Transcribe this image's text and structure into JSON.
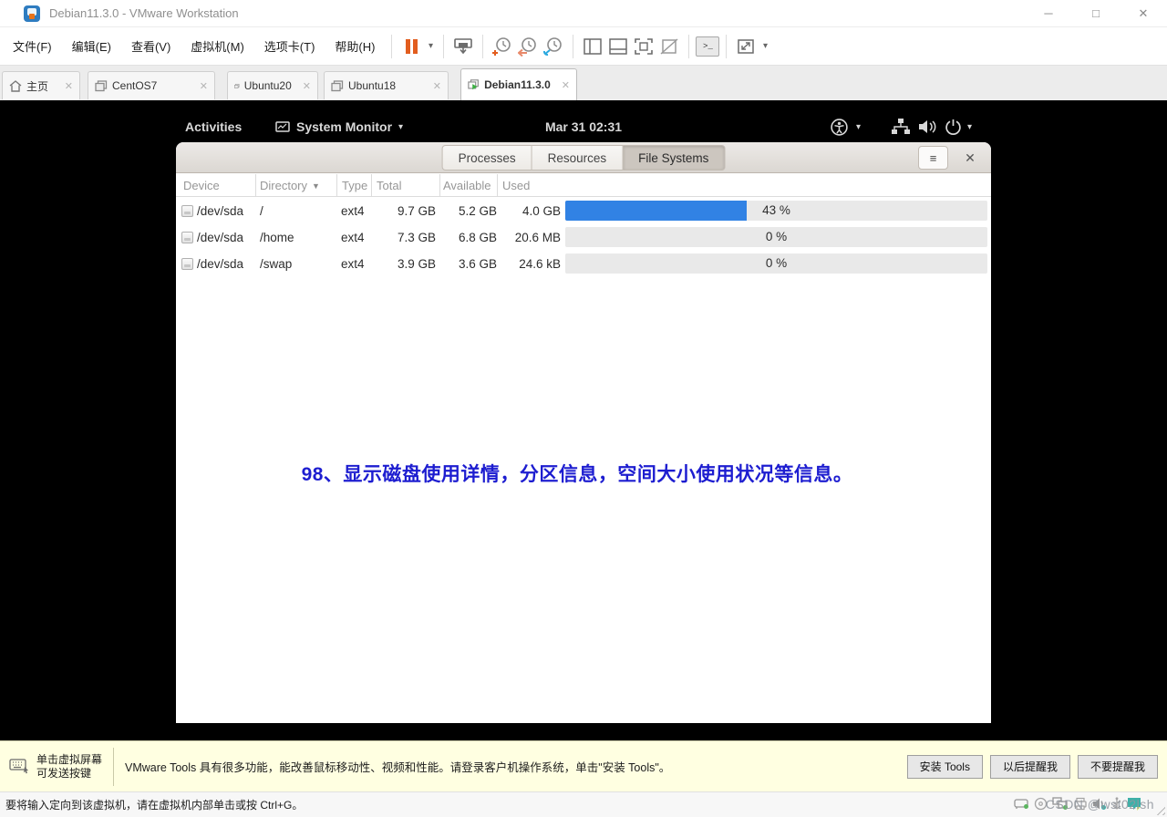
{
  "window": {
    "title": "Debian11.3.0 - VMware Workstation"
  },
  "icons": {
    "minimize_glyph": "─",
    "maximize_glyph": "□",
    "close_glyph": "✕",
    "tab_close_glyph": "✕",
    "caret_glyph": "▾",
    "sort_desc_glyph": "▼",
    "hamburger_glyph": "≡",
    "prompt_glyph": ">_"
  },
  "menu": {
    "items": [
      "文件(F)",
      "编辑(E)",
      "查看(V)",
      "虚拟机(M)",
      "选项卡(T)",
      "帮助(H)"
    ]
  },
  "vm_tabs": {
    "items": [
      {
        "label": "主页"
      },
      {
        "label": "CentOS7"
      },
      {
        "label": "Ubuntu20"
      },
      {
        "label": "Ubuntu18"
      },
      {
        "label": "Debian11.3.0"
      }
    ],
    "active": "Debian11.3.0"
  },
  "gnome": {
    "activities": "Activities",
    "app_name": "System Monitor",
    "clock": "Mar 31  02:31"
  },
  "monitor": {
    "tabs": {
      "processes": "Processes",
      "resources": "Resources",
      "file_systems": "File Systems"
    },
    "active_tab": "File Systems",
    "columns": {
      "device": "Device",
      "directory": "Directory",
      "type": "Type",
      "total": "Total",
      "available": "Available",
      "used": "Used"
    },
    "rows": [
      {
        "device": "/dev/sda",
        "directory": "/",
        "type": "ext4",
        "total": "9.7 GB",
        "available": "5.2 GB",
        "used": "4.0 GB",
        "percent": 43,
        "percent_label": "43 %"
      },
      {
        "device": "/dev/sda",
        "directory": "/home",
        "type": "ext4",
        "total": "7.3 GB",
        "available": "6.8 GB",
        "used": "20.6 MB",
        "percent": 0,
        "percent_label": "0 %"
      },
      {
        "device": "/dev/sda",
        "directory": "/swap",
        "type": "ext4",
        "total": "3.9 GB",
        "available": "3.6 GB",
        "used": "24.6 kB",
        "percent": 0,
        "percent_label": "0 %"
      }
    ]
  },
  "annotation": {
    "text": "98、显示磁盘使用详情，分区信息，空间大小使用状况等信息。"
  },
  "tools_bar": {
    "hint_line1": "单击虚拟屏幕",
    "hint_line2": "可发送按键",
    "message": "VMware Tools 具有很多功能，能改善鼠标移动性、视频和性能。请登录客户机操作系统，单击\"安装 Tools\"。",
    "buttons": [
      "安装 Tools",
      "以后提醒我",
      "不要提醒我"
    ]
  },
  "status_bar": {
    "message": "要将输入定向到该虚拟机，请在虚拟机内部单击或按 Ctrl+G。",
    "watermark": "CSDN @wst02lsh"
  },
  "colors": {
    "accent_blue": "#3182e4",
    "annotation_blue": "#1d1dd0",
    "notification_bg": "#ffffe1",
    "pause_orange": "#e25d1e"
  }
}
